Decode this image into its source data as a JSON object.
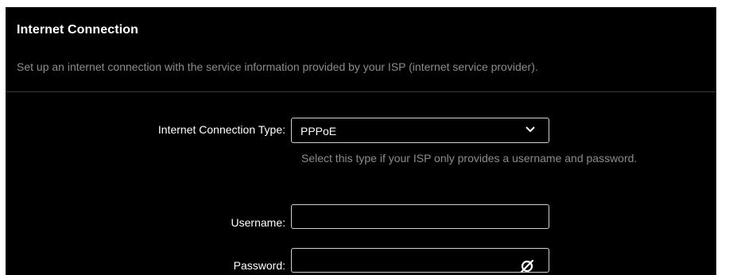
{
  "section": {
    "title": "Internet Connection",
    "description": "Set up an internet connection with the service information provided by your ISP (internet service provider)."
  },
  "connection_type": {
    "label": "Internet Connection Type:",
    "value": "PPPoE",
    "icon": "chevron-down-icon",
    "help": "Select this type if your ISP only provides a username and password."
  },
  "username": {
    "label": "Username:",
    "value": ""
  },
  "password": {
    "label": "Password:",
    "value": "",
    "icon": "eye-slash-icon"
  },
  "colors": {
    "background": "#000000",
    "text": "#ffffff",
    "muted_text": "#8c8c8c",
    "input_border": "#cfcfcf"
  }
}
